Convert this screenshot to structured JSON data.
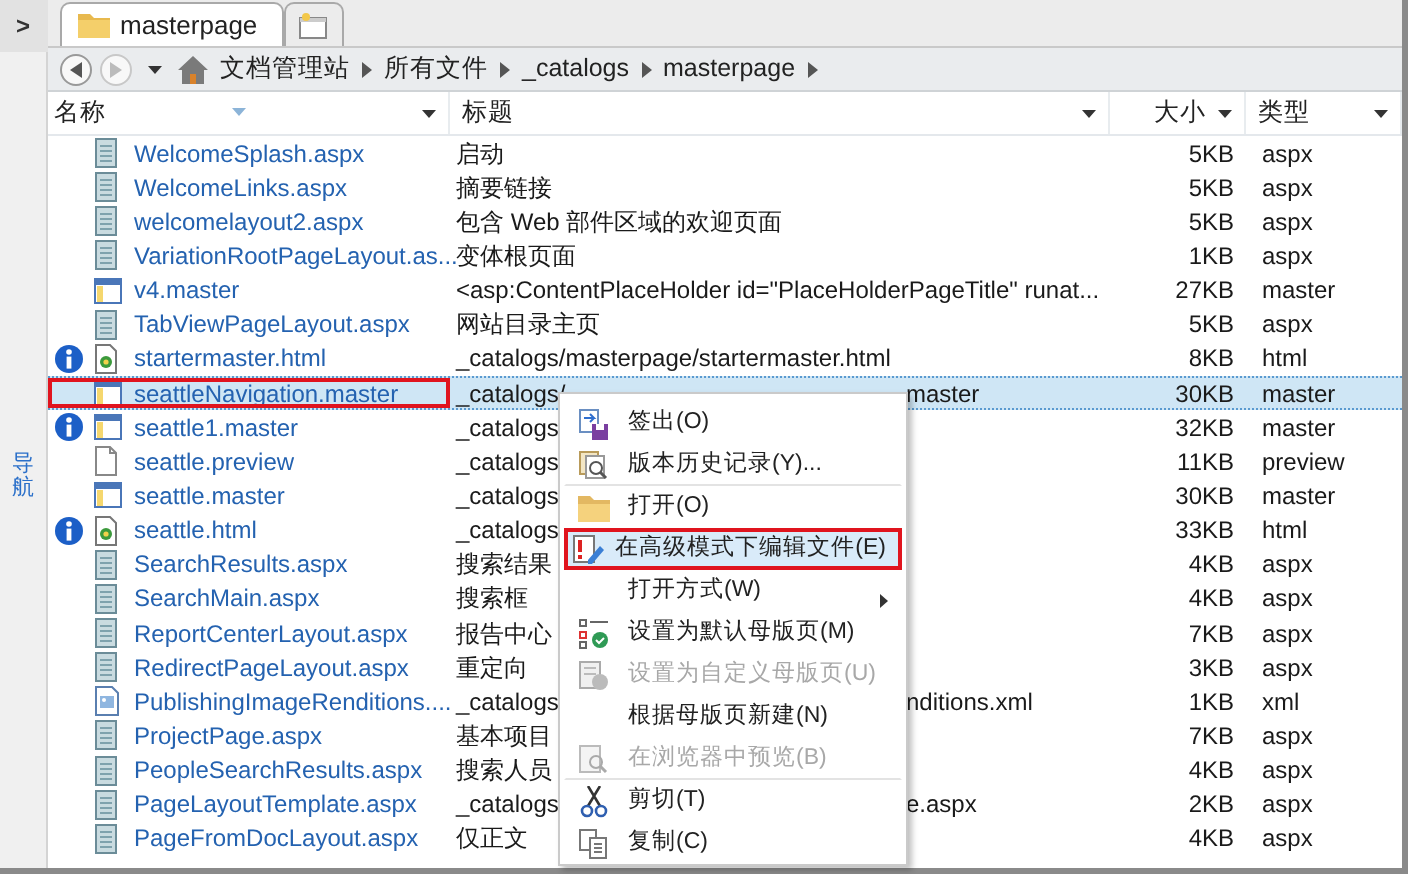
{
  "sidebar": {
    "toggle": ">",
    "label": "导航"
  },
  "tabs": [
    {
      "kind": "folder",
      "label": "masterpage",
      "selected": true
    },
    {
      "kind": "new",
      "selected": false
    }
  ],
  "breadcrumb": [
    "文档管理站",
    "所有文件",
    "_catalogs",
    "masterpage"
  ],
  "columns": [
    {
      "label": "名称"
    },
    {
      "label": "标题"
    },
    {
      "label": "大小"
    },
    {
      "label": "类型"
    }
  ],
  "rows": [
    {
      "kind": "page",
      "name": "WelcomeSplash.aspx",
      "title": "启动",
      "size": "5KB",
      "type": "aspx",
      "selected": false
    },
    {
      "kind": "page",
      "name": "WelcomeLinks.aspx",
      "title": "摘要链接",
      "size": "5KB",
      "type": "aspx",
      "selected": false
    },
    {
      "kind": "page",
      "name": "welcomelayout2.aspx",
      "title": "包含 Web 部件区域的欢迎页面",
      "size": "5KB",
      "type": "aspx",
      "selected": false
    },
    {
      "kind": "page",
      "name": "VariationRootPageLayout.as...",
      "title": "变体根页面",
      "size": "1KB",
      "type": "aspx",
      "selected": false
    },
    {
      "kind": "master",
      "name": "v4.master",
      "title": "<asp:ContentPlaceHolder id=\"PlaceHolderPageTitle\" runat...",
      "size": "27KB",
      "type": "master",
      "selected": false
    },
    {
      "kind": "page",
      "name": "TabViewPageLayout.aspx",
      "title": "网站目录主页",
      "size": "5KB",
      "type": "aspx",
      "selected": false
    },
    {
      "kind": "html",
      "name": "startermaster.html",
      "title": "_catalogs/masterpage/startermaster.html",
      "size": "8KB",
      "type": "html",
      "info": true,
      "selected": false
    },
    {
      "kind": "master",
      "name": "seattleNavigation.master",
      "title": "_catalogs/",
      "title_tail": "master",
      "size": "30KB",
      "type": "master",
      "selected": true,
      "marked": true
    },
    {
      "kind": "master",
      "name": "seattle1.master",
      "title": "_catalogs",
      "size": "32KB",
      "type": "master",
      "info": true,
      "selected": false
    },
    {
      "kind": "preview",
      "name": "seattle.preview",
      "title": "_catalogs",
      "size": "11KB",
      "type": "preview",
      "selected": false
    },
    {
      "kind": "master",
      "name": "seattle.master",
      "title": "_catalogs",
      "size": "30KB",
      "type": "master",
      "selected": false
    },
    {
      "kind": "html",
      "name": "seattle.html",
      "title": "_catalogs",
      "size": "33KB",
      "type": "html",
      "info": true,
      "selected": false
    },
    {
      "kind": "page",
      "name": "SearchResults.aspx",
      "title": "搜索结果",
      "size": "4KB",
      "type": "aspx",
      "selected": false
    },
    {
      "kind": "page",
      "name": "SearchMain.aspx",
      "title": "搜索框",
      "size": "4KB",
      "type": "aspx",
      "selected": false
    },
    {
      "kind": "page",
      "name": "ReportCenterLayout.aspx",
      "title": "报告中心",
      "size": "7KB",
      "type": "aspx",
      "selected": false
    },
    {
      "kind": "page",
      "name": "RedirectPageLayout.aspx",
      "title": "重定向",
      "size": "3KB",
      "type": "aspx",
      "selected": false
    },
    {
      "kind": "xml",
      "name": "PublishingImageRenditions....",
      "title": "_catalogs",
      "title_tail": "nditions.xml",
      "size": "1KB",
      "type": "xml",
      "selected": false
    },
    {
      "kind": "page",
      "name": "ProjectPage.aspx",
      "title": "基本项目",
      "size": "7KB",
      "type": "aspx",
      "selected": false
    },
    {
      "kind": "page",
      "name": "PeopleSearchResults.aspx",
      "title": "搜索人员",
      "size": "4KB",
      "type": "aspx",
      "selected": false
    },
    {
      "kind": "page",
      "name": "PageLayoutTemplate.aspx",
      "title": "_catalogs",
      "title_tail": "e.aspx",
      "size": "2KB",
      "type": "aspx",
      "selected": false
    },
    {
      "kind": "page",
      "name": "PageFromDocLayout.aspx",
      "title": "仅正文",
      "size": "4KB",
      "type": "aspx",
      "selected": false
    }
  ],
  "context_menu": [
    {
      "label": "签出(O)",
      "disabled": false,
      "highlighted": false,
      "submenu": false,
      "separator_after": false
    },
    {
      "label": "版本历史记录(Y)...",
      "disabled": false,
      "highlighted": false,
      "submenu": false,
      "separator_after": true
    },
    {
      "label": "打开(O)",
      "disabled": false,
      "highlighted": false,
      "submenu": false,
      "separator_after": false
    },
    {
      "label": "在高级模式下编辑文件(E)",
      "disabled": false,
      "highlighted": true,
      "marked": true,
      "submenu": false,
      "separator_after": false
    },
    {
      "label": "打开方式(W)",
      "disabled": false,
      "highlighted": false,
      "submenu": true,
      "separator_after": false
    },
    {
      "label": "设置为默认母版页(M)",
      "disabled": false,
      "highlighted": false,
      "submenu": false,
      "separator_after": false
    },
    {
      "label": "设置为自定义母版页(U)",
      "disabled": true,
      "highlighted": false,
      "submenu": false,
      "separator_after": false
    },
    {
      "label": "根据母版页新建(N)",
      "disabled": false,
      "highlighted": false,
      "submenu": false,
      "separator_after": false
    },
    {
      "label": "在浏览器中预览(B)",
      "disabled": true,
      "highlighted": false,
      "submenu": false,
      "separator_after": true
    },
    {
      "label": "剪切(T)",
      "disabled": false,
      "highlighted": false,
      "submenu": false,
      "separator_after": false
    },
    {
      "label": "复制(C)",
      "disabled": false,
      "highlighted": false,
      "submenu": false,
      "separator_after": false
    }
  ]
}
